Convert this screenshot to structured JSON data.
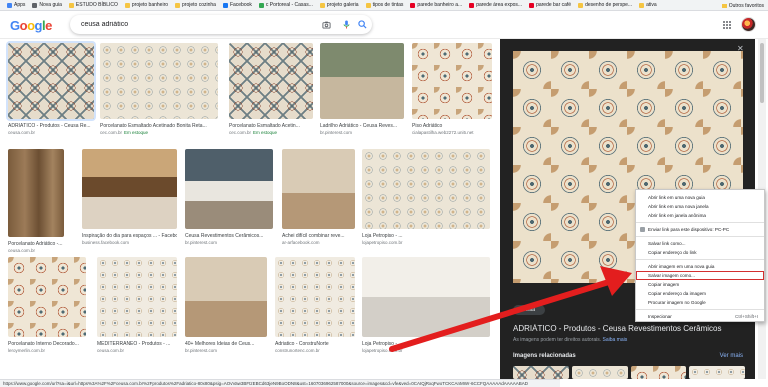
{
  "bookmarks": [
    {
      "label": "Apps",
      "color": "#4285f4"
    },
    {
      "label": "Nova guia",
      "color": "#5f6368"
    },
    {
      "label": "ESTUDO BÍBLICO",
      "color": "#f5c542"
    },
    {
      "label": "projeto banheiro",
      "color": "#f5c542"
    },
    {
      "label": "projeto cozinha",
      "color": "#f5c542"
    },
    {
      "label": "Facebook",
      "color": "#1877f2"
    },
    {
      "label": "c Portoreal - Casas...",
      "color": "#34a853"
    },
    {
      "label": "projeto galeria",
      "color": "#f5c542"
    },
    {
      "label": "tipos de tintas",
      "color": "#f5c542"
    },
    {
      "label": "parede banheiro a...",
      "color": "#e60023"
    },
    {
      "label": "parede área expos...",
      "color": "#e60023"
    },
    {
      "label": "parede bar café",
      "color": "#e60023"
    },
    {
      "label": "desenho de perspe...",
      "color": "#f5c542"
    },
    {
      "label": "ativa",
      "color": "#f5c542"
    }
  ],
  "bookmarks_other": "Outros favoritos",
  "search": {
    "query": "ceusa adriático"
  },
  "results": [
    {
      "title": "ADRIÁTICO - Produtos - Ceusa Re...",
      "source": "ceusa.com.br",
      "stock": "",
      "pattern": "tileA"
    },
    {
      "title": "Porcelanato Esmaltado Acetinado Bonita Reta...",
      "source": "cec.com.br",
      "stock": "Em estoque",
      "pattern": "tileB"
    },
    {
      "title": "Porcelanato Esmaltado Acetin...",
      "source": "cec.com.br",
      "stock": "Em estoque",
      "pattern": "tileA"
    },
    {
      "title": "Ladrilho Adriático - Ceusa Reves...",
      "source": "br.pinterest.com",
      "stock": "",
      "pattern": "patio"
    },
    {
      "title": "Piso Adriático",
      "source": "cialapastilha.web2272.uni5.net",
      "stock": "",
      "pattern": "tileC"
    },
    {
      "title": "Porcelanato Adriático -...",
      "source": "ceusa.com.br",
      "stock": "",
      "pattern": "wood"
    },
    {
      "title": "Inspiração do dia para espaços ... - Facebook",
      "source": "business.facebook.com",
      "stock": "",
      "pattern": "kitchen"
    },
    {
      "title": "Ceusa Revestimentos Cerâmicos...",
      "source": "br.pinterest.com",
      "stock": "",
      "pattern": "bath"
    },
    {
      "title": "Achei difícil combinar reve...",
      "source": "ar-arfacebook.com",
      "stock": "",
      "pattern": "room"
    },
    {
      "title": "Loja Petropiso - ...",
      "source": "lojapetropiso.com.br",
      "stock": "",
      "pattern": "tileB"
    },
    {
      "title": "Porcelanato Interno Decorado...",
      "source": "leroymerlin.com.br",
      "stock": "",
      "pattern": "tileC"
    },
    {
      "title": "MEDITERRÂNEO - Produtos - ...",
      "source": "ceusa.com.br",
      "stock": "",
      "pattern": "tileD"
    },
    {
      "title": "40+ Melhores Ideias de Ceus...",
      "source": "br.pinterest.com",
      "stock": "",
      "pattern": "room"
    },
    {
      "title": "Adriatico - ConstruNorte",
      "source": "construnortenc.com.br",
      "stock": "",
      "pattern": "tileD"
    },
    {
      "title": "Loja Petropiso - ...",
      "source": "lojapetropiso.com.br",
      "stock": "",
      "pattern": "whitebath"
    }
  ],
  "panel": {
    "visit_label": "Visita",
    "title": "ADRIÁTICO - Produtos - Ceusa Revestimentos Cerâmicos",
    "subtitle": "As imagens podem ter direitos autorais.",
    "learn_more": "Saiba mais",
    "related": "Imagens relacionadas",
    "see_more": "Ver mais"
  },
  "context_menu": {
    "items": [
      {
        "label": "Abrir link em uma nova guia",
        "shortcut": ""
      },
      {
        "label": "Abrir link em uma nova janela",
        "shortcut": ""
      },
      {
        "label": "Abrir link em janela anônima",
        "shortcut": ""
      },
      {
        "sep": true
      },
      {
        "label": "Enviar link para este dispositivo: PC-PC",
        "shortcut": "",
        "icon": true
      },
      {
        "sep": true
      },
      {
        "label": "Salvar link como...",
        "shortcut": ""
      },
      {
        "label": "Copiar endereço do link",
        "shortcut": ""
      },
      {
        "sep": true
      },
      {
        "label": "Abrir imagem em uma nova guia",
        "shortcut": ""
      },
      {
        "label": "Salvar imagem como...",
        "shortcut": "",
        "highlight": true
      },
      {
        "label": "Copiar imagem",
        "shortcut": ""
      },
      {
        "label": "Copiar endereço da imagem",
        "shortcut": ""
      },
      {
        "label": "Procurar imagem no Google",
        "shortcut": ""
      },
      {
        "sep": true
      },
      {
        "label": "Inspecionar",
        "shortcut": "Ctrl+Shift+I"
      }
    ]
  },
  "status_url": "https://www.google.com/url?sa=i&url=https%3A%2F%2Fceusa.com.br%2Fprodutos%2Fadriatico-80x80&psig=AOvVaw3BFtzEBCd63jeN9BoODN8&ust=1607036962587000&source=images&cd=vfe&ved=0CAIQjRxqFwoTCKCAnMWr-6CCFQAAAAAdAAAAABAD",
  "colors": {
    "annotation": "#e31e1e",
    "highlight_box": "#d32f2f"
  }
}
